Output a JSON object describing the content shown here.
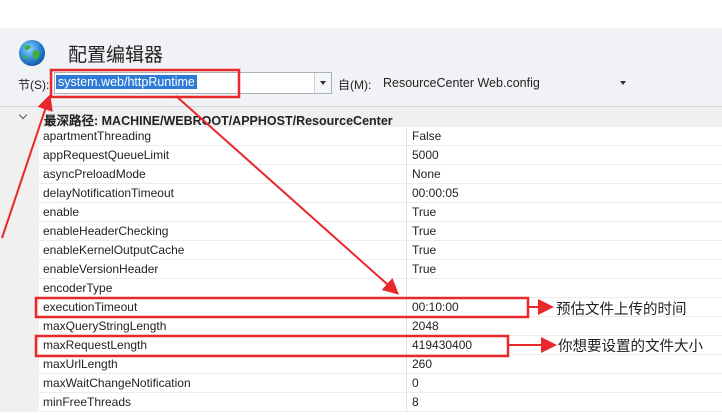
{
  "window": {
    "title": "配置编辑器"
  },
  "toolbar": {
    "section_label": "节(S):",
    "section_value": "system.web/httpRuntime",
    "from_label": "自(M):",
    "from_value": "ResourceCenter Web.config"
  },
  "grid": {
    "group_label": "最深路径: MACHINE/WEBROOT/APPHOST/ResourceCenter",
    "rows": [
      {
        "name": "apartmentThreading",
        "value": "False"
      },
      {
        "name": "appRequestQueueLimit",
        "value": "5000"
      },
      {
        "name": "asyncPreloadMode",
        "value": "None"
      },
      {
        "name": "delayNotificationTimeout",
        "value": "00:00:05"
      },
      {
        "name": "enable",
        "value": "True"
      },
      {
        "name": "enableHeaderChecking",
        "value": "True"
      },
      {
        "name": "enableKernelOutputCache",
        "value": "True"
      },
      {
        "name": "enableVersionHeader",
        "value": "True"
      },
      {
        "name": "encoderType",
        "value": ""
      },
      {
        "name": "executionTimeout",
        "value": "00:10:00"
      },
      {
        "name": "maxQueryStringLength",
        "value": "2048"
      },
      {
        "name": "maxRequestLength",
        "value": "419430400"
      },
      {
        "name": "maxUrlLength",
        "value": "260"
      },
      {
        "name": "maxWaitChangeNotification",
        "value": "0"
      },
      {
        "name": "minFreeThreads",
        "value": "8"
      }
    ]
  },
  "annotations": {
    "execution_timeout_note": "预估文件上传的时间",
    "max_request_length_note": "你想要设置的文件大小"
  },
  "colors": {
    "highlight": "#e8282b",
    "selection": "#2f7ad6"
  }
}
